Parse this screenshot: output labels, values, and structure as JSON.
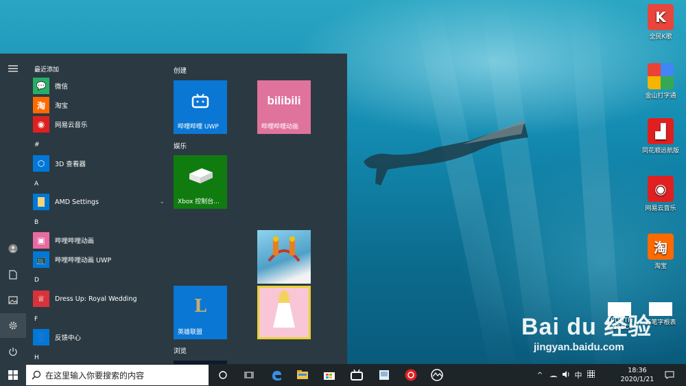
{
  "desktop_icons": [
    {
      "label": "全民K歌",
      "icon": "kge-icon",
      "color": "#e8453c"
    },
    {
      "label": "金山打字通",
      "icon": "typing-icon",
      "color": "#f4b400"
    },
    {
      "label": "同花顺远航版",
      "icon": "stock-icon",
      "color": "#e02020"
    },
    {
      "label": "网易云音乐",
      "icon": "netease-icon",
      "color": "#e02020"
    },
    {
      "label": "淘宝",
      "icon": "taobao-icon",
      "color": "#ff6a00"
    },
    {
      "label": "19DUTR\n3_255CT",
      "icon": "image-file-icon",
      "color": "#ffffff"
    },
    {
      "label": "五笔字根表",
      "icon": "image-file-icon",
      "color": "#ffffff"
    }
  ],
  "start_menu": {
    "rail": [
      "menu-icon",
      "user-icon",
      "document-icon",
      "pictures-icon",
      "settings-icon",
      "power-icon"
    ],
    "recent_header": "最近添加",
    "recent": [
      {
        "label": "微信",
        "color": "#2aae67",
        "glyph": "💬"
      },
      {
        "label": "淘宝",
        "color": "#ff6a00",
        "glyph": "淘"
      },
      {
        "label": "网易云音乐",
        "color": "#e02020",
        "glyph": "◉"
      }
    ],
    "sections": [
      {
        "letter": "#",
        "apps": [
          {
            "label": "3D 查看器",
            "color": "#0078d7",
            "glyph": "⬡"
          }
        ]
      },
      {
        "letter": "A",
        "apps": [
          {
            "label": "AMD Settings",
            "color": "#0078d7",
            "glyph": "▮",
            "expand": "⌄"
          }
        ]
      },
      {
        "letter": "B",
        "apps": [
          {
            "label": "哔哩哔哩动画",
            "color": "#e86ba1",
            "glyph": "▣"
          },
          {
            "label": "哔哩哔哩动画 UWP",
            "color": "#0078d7",
            "glyph": "📺"
          }
        ]
      },
      {
        "letter": "D",
        "apps": [
          {
            "label": "Dress Up: Royal Wedding",
            "color": "#d8323a",
            "glyph": "♕"
          }
        ]
      },
      {
        "letter": "F",
        "apps": [
          {
            "label": "反馈中心",
            "color": "#0078d7",
            "glyph": "👤"
          }
        ]
      },
      {
        "letter": "H",
        "apps": []
      }
    ],
    "groups": [
      {
        "name": "创建"
      },
      {
        "name": "娱乐"
      },
      {
        "name": "浏览"
      }
    ],
    "tiles": [
      {
        "label": "哔哩哔哩 UWP",
        "color": "#0a77d5",
        "glyph": "📺"
      },
      {
        "label": "哔哩哔哩动画",
        "color": "#e0739c",
        "glyph": "bilibili"
      },
      {
        "label": "Xbox 控制台...",
        "color": "#107c10",
        "glyph": "▬"
      },
      {
        "label": "",
        "color": "#6fb6d8",
        "glyph": ""
      },
      {
        "label": "英雄联盟",
        "color": "#0a77d5",
        "glyph": "L"
      },
      {
        "label": "",
        "color": "#f8c6d6",
        "glyph": ""
      }
    ]
  },
  "taskbar": {
    "search_placeholder": "在这里输入你要搜索的内容",
    "apps": [
      "cortana-icon",
      "task-view-icon",
      "edge-icon",
      "explorer-icon",
      "store-icon",
      "bilibili-icon",
      "photo-icon",
      "netease-icon",
      "browser-icon"
    ],
    "ime": "中",
    "time": "18:36",
    "date": "2020/1/21"
  },
  "watermark": {
    "brand": "Bai du 经验",
    "url": "jingyan.baidu.com"
  }
}
